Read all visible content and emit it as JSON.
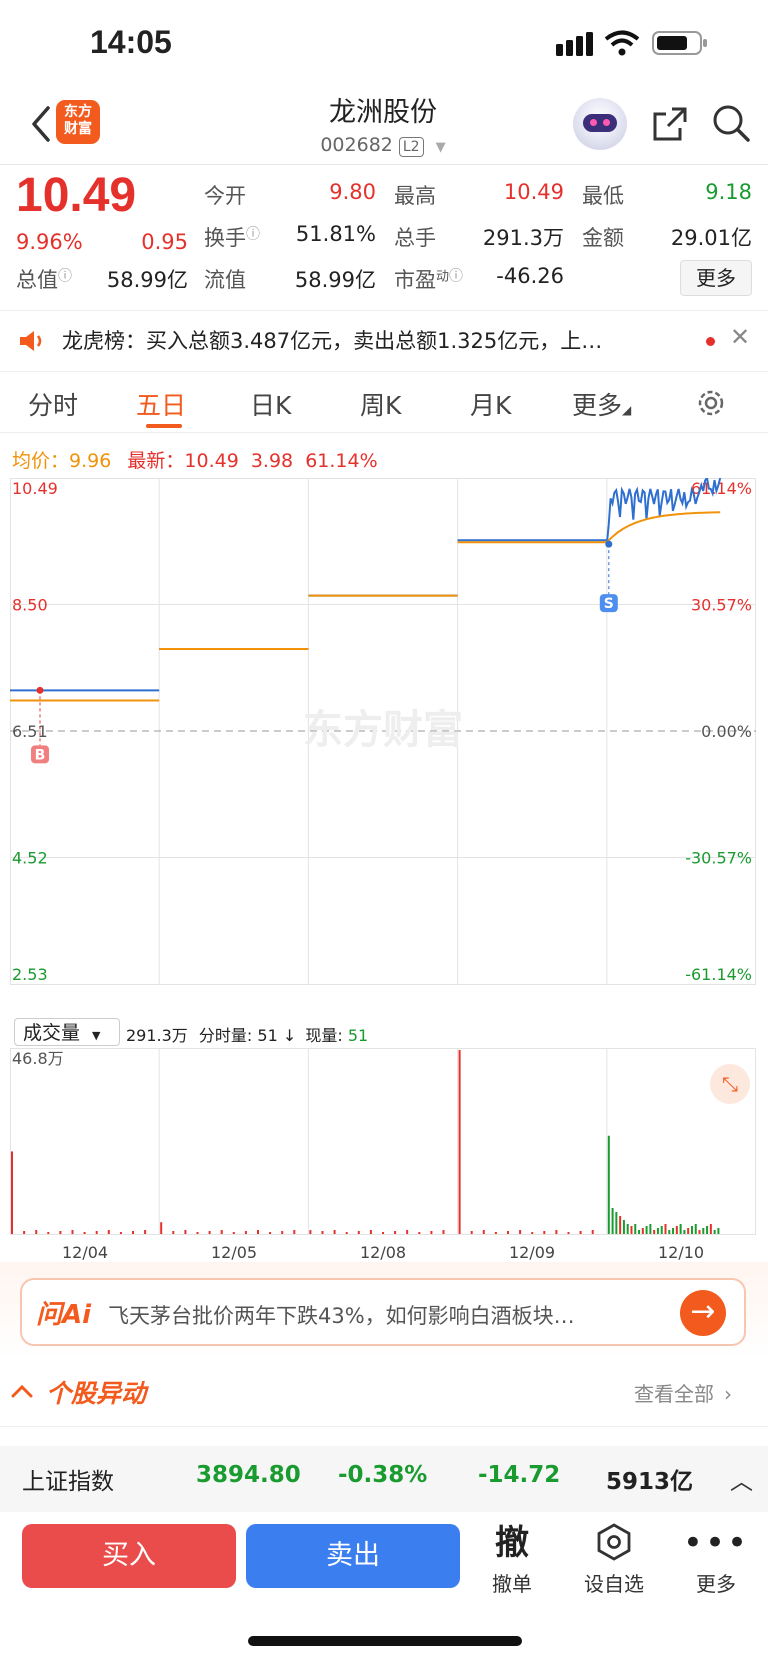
{
  "status_bar": {
    "time": "14:05"
  },
  "header": {
    "app_logo": "东方\n财富",
    "stock_name": "龙洲股份",
    "stock_code": "002682",
    "level_badge": "L2",
    "icons": [
      "back-icon",
      "robot-avatar-icon",
      "share-icon",
      "search-icon"
    ]
  },
  "quote": {
    "price": "10.49",
    "change_pct": "9.96%",
    "change_amt": "0.95",
    "open_label": "今开",
    "open": "9.80",
    "high_label": "最高",
    "high": "10.49",
    "low_label": "最低",
    "low": "9.18",
    "turnover_label": "换手",
    "turnover": "51.81%",
    "volume_label": "总手",
    "volume": "291.3万",
    "amount_label": "金额",
    "amount": "29.01亿",
    "mktcap_label": "总值",
    "mktcap": "58.99亿",
    "float_label": "流值",
    "float": "58.99亿",
    "pe_label": "市盈",
    "pe_sup": "动",
    "pe": "-46.26",
    "more_button": "更多"
  },
  "lhb": {
    "text": "龙虎榜：买入总额3.487亿元，卖出总额1.325亿元，上…"
  },
  "tabs": [
    "分时",
    "五日",
    "日K",
    "周K",
    "月K",
    "更多"
  ],
  "active_tab": "五日",
  "chart_info": {
    "avg_label": "均价：",
    "avg": "9.96",
    "latest_label": "最新：",
    "latest": "10.49",
    "chg": "3.98",
    "chg_pct": "61.14%"
  },
  "volume_bar": {
    "selector": "成交量",
    "total": "291.3万",
    "fs_label": "分时量:",
    "fs_val": "51",
    "now_label": "现量:",
    "now_val": "51"
  },
  "ai_banner": {
    "logo": "问Ai",
    "text": "飞天茅台批价两年下跌43%，如何影响白酒板块…"
  },
  "yidong": {
    "title": "个股异动",
    "view_all": "查看全部"
  },
  "index_bar": {
    "name": "上证指数",
    "value": "3894.80",
    "pct": "-0.38%",
    "chg": "-14.72",
    "amount": "5913亿"
  },
  "actions": {
    "buy": "买入",
    "sell": "卖出",
    "cancel_icon": "撤",
    "cancel": "撤单",
    "watch": "设自选",
    "more": "更多"
  },
  "chart_data": {
    "type": "line",
    "title": "",
    "watermark": "东方财富",
    "days": [
      "12/04",
      "12/05",
      "12/08",
      "12/09",
      "12/10"
    ],
    "price_ticks": [
      "10.49",
      "8.50",
      "6.51",
      "4.52",
      "2.53"
    ],
    "pct_ticks": [
      "61.14%",
      "30.57%",
      "0.00%",
      "-30.57%",
      "-61.14%"
    ],
    "ylim": [
      2.53,
      10.49
    ],
    "prev_close": 6.51,
    "colors": {
      "price": "#2f6fd0",
      "avg": "#f0920a",
      "up": "#e5312c",
      "down": "#1a9b2f"
    },
    "series": [
      {
        "name": "最新",
        "day_levels": [
          7.15,
          7.8,
          8.64,
          9.51,
          10.2
        ]
      },
      {
        "name": "均价",
        "day_levels": [
          6.99,
          7.8,
          8.64,
          9.48,
          9.96
        ]
      }
    ],
    "buy_marker": {
      "label": "B",
      "price": 7.15
    },
    "sell_marker": {
      "label": "S",
      "price": 9.45
    },
    "volume": {
      "max_label": "46.8万",
      "spikes": [
        {
          "day": 0,
          "value": 21.0
        },
        {
          "day": 1,
          "value": 3.0
        },
        {
          "day": 2,
          "value": 1.0
        },
        {
          "day": 3,
          "value": 46.8
        },
        {
          "day": 4,
          "value": 25.0
        }
      ]
    }
  }
}
